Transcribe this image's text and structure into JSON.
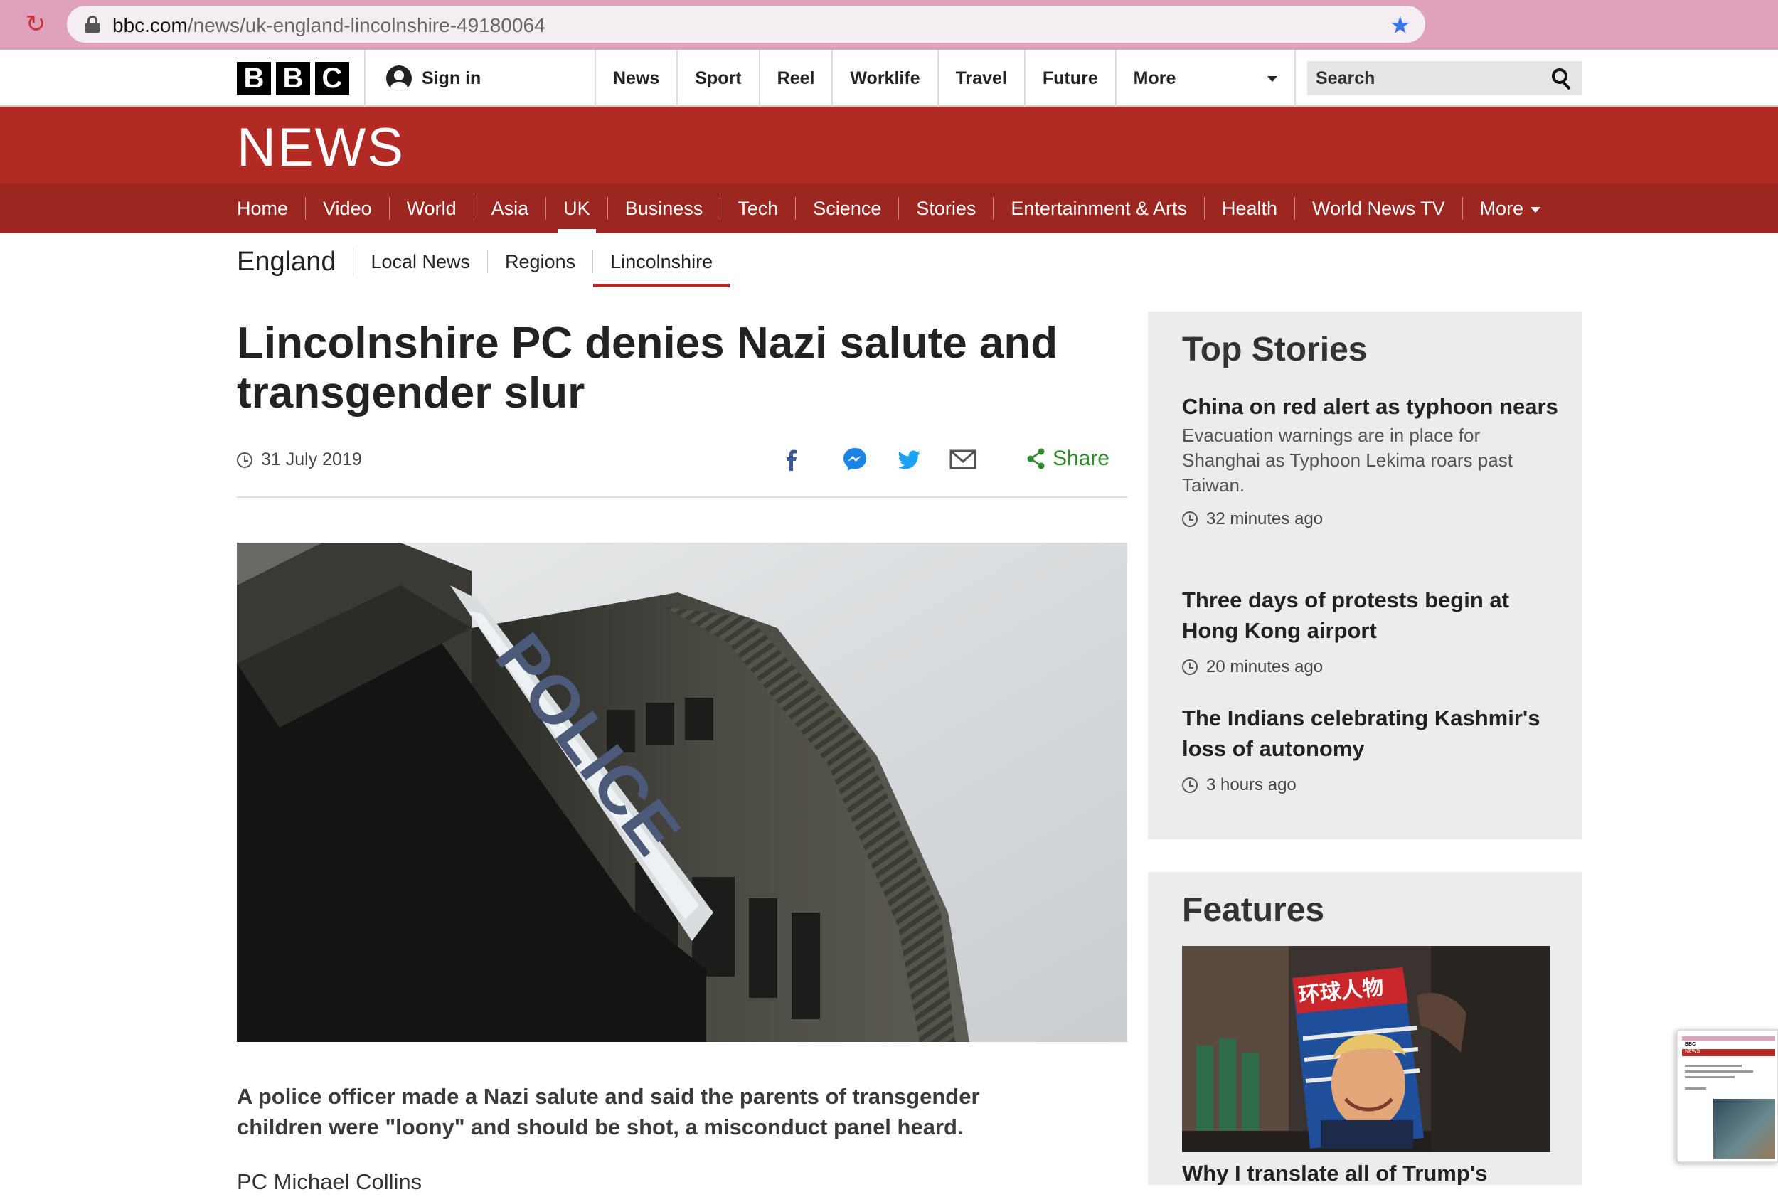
{
  "browser": {
    "url_host": "bbc.com",
    "url_path": "/news/uk-england-lincolnshire-49180064"
  },
  "masthead": {
    "logo_letters": [
      "B",
      "B",
      "C"
    ],
    "sign_in": "Sign in",
    "nav": [
      "News",
      "Sport",
      "Reel",
      "Worklife",
      "Travel",
      "Future",
      "More"
    ],
    "search_placeholder": "Search"
  },
  "news": {
    "wordmark": "NEWS",
    "nav": [
      "Home",
      "Video",
      "World",
      "Asia",
      "UK",
      "Business",
      "Tech",
      "Science",
      "Stories",
      "Entertainment & Arts",
      "Health",
      "World News TV",
      "More"
    ],
    "active": "UK"
  },
  "subnav": {
    "region": "England",
    "items": [
      "Local News",
      "Regions",
      "Lincolnshire"
    ],
    "active": "Lincolnshire"
  },
  "article": {
    "headline": "Lincolnshire PC denies Nazi salute and transgender slur",
    "date": "31 July 2019",
    "share_label": "Share",
    "hero_sign_text": "POLICE",
    "summary": "A police officer made a Nazi salute and said the parents of transgender children were \"loony\" and should be shot, a misconduct panel heard.",
    "body_preview": "PC Michael Collins"
  },
  "sidebar": {
    "top_stories_title": "Top Stories",
    "stories": [
      {
        "title": "China on red alert as typhoon nears",
        "summary": "Evacuation warnings are in place for Shanghai as Typhoon Lekima roars past Taiwan.",
        "time": "32 minutes ago"
      },
      {
        "title": "Three days of protests begin at Hong Kong airport",
        "summary": "",
        "time": "20 minutes ago"
      },
      {
        "title": "The Indians celebrating Kashmir's loss of autonomy",
        "summary": "",
        "time": "3 hours ago"
      }
    ],
    "features_title": "Features",
    "feature_headline": "Why I translate all of Trump's",
    "feature_magazine_title": "环球人物"
  },
  "thumbnail": {
    "logo": "BBC",
    "wordmark": "NEWS"
  },
  "colors": {
    "chrome_bar": "#e0a1bd",
    "bbc_red": "#b22a24",
    "nav_red": "#9c2620",
    "share_green": "#2c8a2c",
    "facebook": "#3b5998",
    "messenger": "#1a84e5",
    "twitter": "#1da1f2",
    "star": "#3b78e7"
  },
  "icons": [
    "reload-icon",
    "lock-icon",
    "bookmark-star-icon",
    "user-icon",
    "search-icon",
    "clock-icon",
    "facebook-icon",
    "messenger-icon",
    "twitter-icon",
    "email-icon",
    "share-icon",
    "caret-down-icon"
  ]
}
